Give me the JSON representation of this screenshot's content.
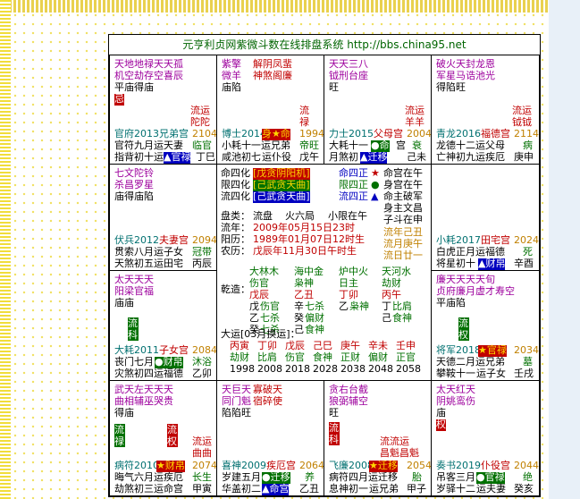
{
  "title": "元亨利贞网紫微斗数在线排盘系统 http://bbs.china95.net",
  "c1": {
    "s1": "天地地禄天天孤",
    "s2": "机空劫存空喜辰",
    "s3": "平庙得庙",
    "hua": "忌",
    "ly1": "流运",
    "ly2": "陀陀",
    "yr": "官府2013兄弟宫",
    "age": "2104",
    "l1": "官符九月运天妻",
    "l1b": "临官",
    "l2": "指背初十运",
    "l2b": "▲官禄",
    "l2c": "丁巳"
  },
  "c2": {
    "s1": "紫擎",
    "s2": "微羊",
    "m1": "解阴凤蜚",
    "m2": "神煞阁廉",
    "s3": "庙陷",
    "ly1": "流",
    "ly2": "禄",
    "yr": "博士2014",
    "badge": "身★命",
    "age": "1994",
    "l1": "小耗十一运兄弟",
    "l1b": "帝旺",
    "l2": "咸池初七",
    "l2b": "运仆役",
    "l2c": "戊午"
  },
  "c3": {
    "s1": "天天三八",
    "s2": "钺刑台座",
    "s3": "旺",
    "ly1": "流运",
    "ly2": "羊羊",
    "yr": "力士2015",
    "yr2": "父母宫",
    "age": "2004",
    "l1": "大耗十一",
    "l1b": "●命",
    "l1c": "宫",
    "l1d": "衰",
    "l2": "月煞初",
    "l2b": "▲迁移",
    "l2c": "己未"
  },
  "c4": {
    "s1": "破火天封龙恩",
    "s2": "军星马诰池光",
    "s3": "得陷旺",
    "ly1": "流运",
    "ly2": "钺钺",
    "yr": "青龙2016",
    "yr2": "福德宫",
    "age": "2114",
    "l1": "龙德十二运父母",
    "l1b": "病",
    "l2": "亡神初九运疾厄",
    "l2b": "庚申"
  },
  "c5": {
    "s1": "七文陀铃",
    "s2": "杀昌罗星",
    "s3": "庙得庙陷",
    "yr": "伏兵2012",
    "yr2": "夫妻宫",
    "age": "2094",
    "l1": "贯索八月运子女",
    "l1b": "冠带",
    "l2": "天煞初五运田宅",
    "l2b": "丙辰"
  },
  "c8": {
    "yr": "小耗2017",
    "yr2": "田宅宫",
    "age": "2024",
    "l1": "白虎正月运福德",
    "l1b": "死",
    "l2": "将星初十",
    "l2b": "▲财帛",
    "l2c": "辛酉"
  },
  "c9": {
    "s1": "太天天天",
    "s2": "阳梁官福",
    "s3": "庙庙",
    "vr": "流科",
    "yr": "大耗2011",
    "yr2": "子女宫",
    "age": "2084",
    "l1": "丧门七月",
    "l1b": "●财帛",
    "l1c": "沐浴",
    "l2": "灾煞初四运福德",
    "l2b": "乙卯"
  },
  "c12": {
    "s1": "廉天天天天旬",
    "s2": "贞府廉月虚才寿空",
    "s3": "平庙陷",
    "vr": "流权",
    "yr": "将军2018",
    "badge": "★官禄",
    "age": "2034",
    "l1": "天德二月运兄弟",
    "l1b": "墓",
    "l2": "攀鞍十一",
    "l2b": "运子女",
    "l2c": "壬戌"
  },
  "c13": {
    "s1": "武天左天天天",
    "s2": "曲相辅巫哭贵",
    "s3": "得庙",
    "vr1": "流禄",
    "vr2": "流权",
    "ly1": "流运",
    "ly2": "曲曲",
    "yr": "病符2010",
    "badge": "★财帛",
    "age": "2074",
    "l1": "晦气六月运疾厄",
    "l1b": "长生",
    "l2": "劫煞初三运命宫",
    "l2b": "甲寅"
  },
  "c14": {
    "s1": "天巨天",
    "s2": "同门魁",
    "m1": "寡破天",
    "m2": "宿碎使",
    "s3": "陷陷旺",
    "yr": "喜神2009",
    "yr2": "疾厄宫",
    "age": "2064",
    "l1": "岁建五月",
    "l1b": "●迁移",
    "l1c": "养",
    "l2": "华盖初二",
    "l2b": "▲命宫",
    "l2c": "乙丑"
  },
  "c15": {
    "s1": "贪右台截",
    "s2": "狼弼辅空",
    "s3": "旺",
    "vr1": "流科",
    "vr2": "流权",
    "ly1": "流流运",
    "ly2": "昌魁昌魁",
    "yr": "飞廉2008",
    "badge": "★迁移",
    "age": "2054",
    "l1": "病符四月运迁移",
    "l1b": "胎",
    "l2": "息神初一",
    "l2b": "运兄弟",
    "l2c": "甲子"
  },
  "c16": {
    "s1": "太天红天",
    "s2": "阴姚鸾伤",
    "s3": "庙",
    "hua": "权",
    "yr": "奏书2019",
    "yr2": "仆役宫",
    "age": "2044",
    "l1": "吊客三月",
    "l1b": "●官禄",
    "l1c": "绝",
    "l2": "岁驿十二",
    "l2b": "运夫妻",
    "l2c": "癸亥"
  },
  "center": {
    "h1a": "命四化",
    "h1b": "[戊贪阴阳机]",
    "h1c": "命四正",
    "h1d": "★",
    "h1e": "命宫在午",
    "h2a": "限四化",
    "h2b": "[己武贪天曲]",
    "h2c": "限四正",
    "h2d": "●",
    "h2e": "身宫在午",
    "h3a": "流四化",
    "h3b": "[己武贪天曲]",
    "h3c": "流四正",
    "h3d": "▲",
    "h3e": "命主破军",
    "h4e": "身主文昌",
    "h5e": "子斗在申",
    "r1a": "盘类：",
    "r1b": "流盘",
    "r1c": "火六局",
    "r1d": "小限在午",
    "r2a": "流年：",
    "r2b": "2009年05月15日23时",
    "r2c": "流年己丑",
    "r3a": "阳历：",
    "r3b": "1989年01月07日12时生",
    "r3c": "流月庚午",
    "r4a": "农历：",
    "r4b": "戊辰年11月30日午时生",
    "r4c": "流日廿一",
    "qz": "乾造：",
    "g1a": "大林木",
    "g1b": "伤官",
    "g1c": "戊辰",
    "g1d": "戊",
    "g1e": "伤官",
    "g1f": "乙",
    "g1g": "七杀",
    "g1h": "癸",
    "g1i": "七杀",
    "g2a": "海中金",
    "g2b": "枭神",
    "g2c": "乙丑",
    "g2d": "辛",
    "g2e": "七杀",
    "g2f": "癸",
    "g2g": "偏财",
    "g2h": "己",
    "g2i": "食神",
    "g3a": "炉中火",
    "g3b": "日主",
    "g3c": "丁卯",
    "g3d": "乙",
    "g3e": "枭神",
    "g4a": "天河水",
    "g4b": "劫财",
    "g4c": "丙午",
    "g4d": "丁",
    "g4e": "比肩",
    "g4f": "己",
    "g4g": "食神",
    "dy": "大运[03月换运]：",
    "dyg": [
      "丙寅",
      "丁卯",
      "戊辰",
      "己巳",
      "庚午",
      "辛未",
      "壬申"
    ],
    "dys": [
      "劫财",
      "比肩",
      "伤官",
      "食神",
      "正财",
      "偏财",
      "正官"
    ],
    "dyy": [
      "1998",
      "2008",
      "2018",
      "2028",
      "2038",
      "2048",
      "2058"
    ]
  }
}
